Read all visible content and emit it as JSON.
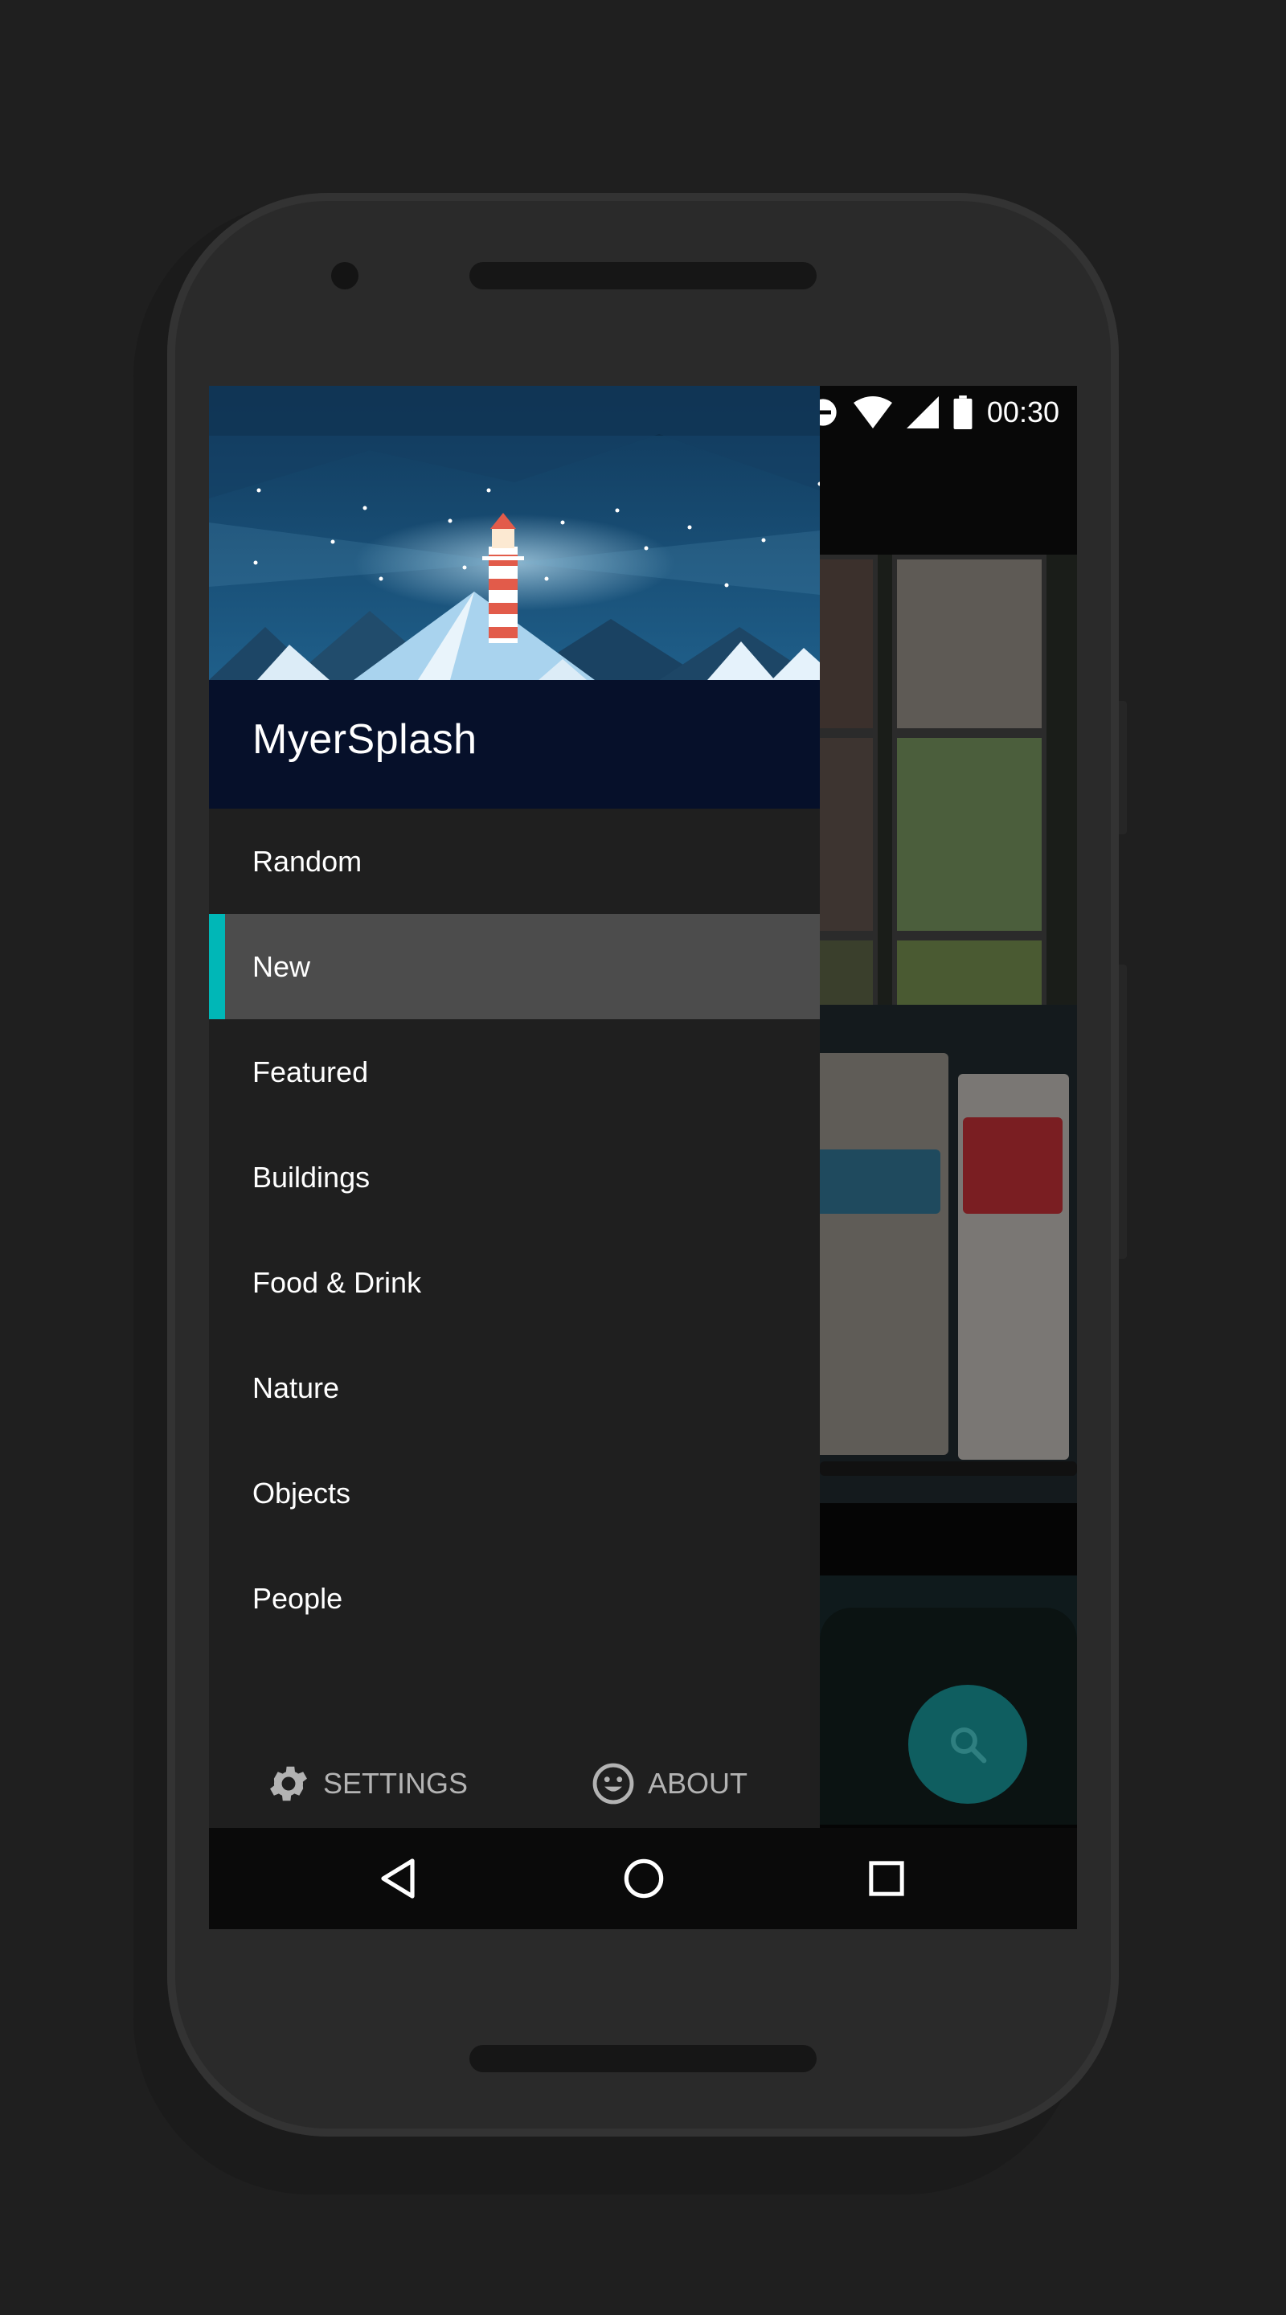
{
  "status_bar": {
    "time": "00:30",
    "icons": [
      "do-not-disturb-icon",
      "wifi-icon",
      "signal-icon",
      "battery-icon"
    ]
  },
  "drawer": {
    "app_title": "MyerSplash",
    "menu": [
      {
        "label": "Random",
        "selected": false
      },
      {
        "label": "New",
        "selected": true
      },
      {
        "label": "Featured",
        "selected": false
      },
      {
        "label": "Buildings",
        "selected": false
      },
      {
        "label": "Food & Drink",
        "selected": false
      },
      {
        "label": "Nature",
        "selected": false
      },
      {
        "label": "Objects",
        "selected": false
      },
      {
        "label": "People",
        "selected": false
      }
    ],
    "footer": {
      "settings_label": "SETTINGS",
      "about_label": "ABOUT"
    }
  },
  "fab": {
    "icon": "search-icon"
  },
  "navbar": {
    "icons": [
      "back-icon",
      "home-icon",
      "recents-icon"
    ]
  },
  "colors": {
    "accent": "#00b7b7",
    "drawer_bg": "#1f1f1f",
    "selected_bg": "#4c4c4c",
    "header_bg": "#06102a",
    "fab_bg": "#0f5e60"
  }
}
